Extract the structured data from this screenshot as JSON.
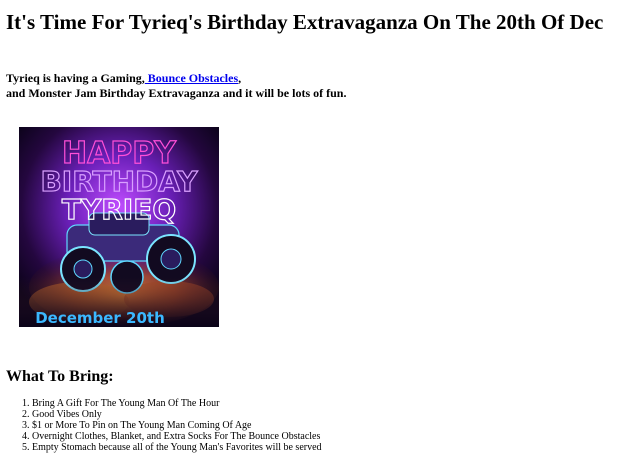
{
  "page": {
    "title": "It's Time For Tyrieq's Birthday Extravaganza On The 20th Of Dec"
  },
  "intro": {
    "text_before": "Tyrieq is having a Gaming,",
    "link_text": " Bounce Obstacles",
    "text_after_link": ",",
    "line2": "and Monster Jam Birthday Extravaganza and it will be lots of fun."
  },
  "poster": {
    "line1": "HAPPY",
    "line2": "BIRTHDAY",
    "line3": "TYRIEQ",
    "date": "December 20th",
    "colors": {
      "neon_pink": "#ff4fd8",
      "neon_purple": "#b06bff",
      "date_blue": "#3bb8ff"
    }
  },
  "bring": {
    "heading": "What To Bring:",
    "items": [
      "Bring A Gift For The Young Man Of The Hour",
      "Good Vibes Only",
      "$1 or More To Pin on The Young Man Coming Of Age",
      "Overnight Clothes, Blanket, and Extra Socks For The Bounce Obstacles",
      "Empty Stomach because all of the Young Man's Favorites will be served"
    ]
  }
}
